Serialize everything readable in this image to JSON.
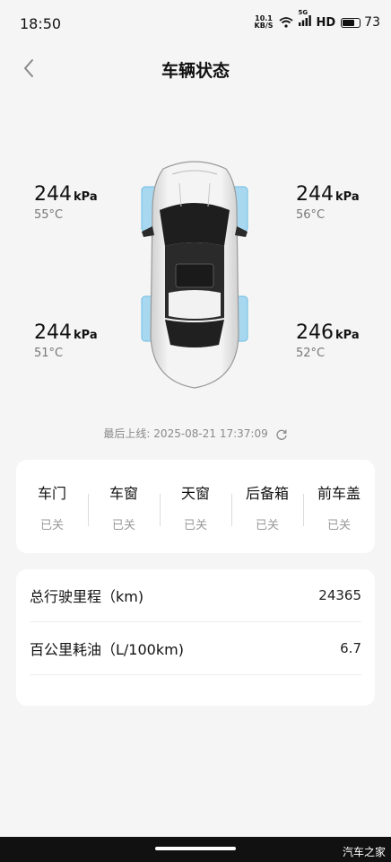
{
  "status_bar": {
    "time": "18:50",
    "speed_top": "10.1",
    "speed_bottom": "KB/S",
    "network": "5G",
    "hd": "HD",
    "battery": "73",
    "battery_level": 0.73
  },
  "header": {
    "title": "车辆状态"
  },
  "tires": {
    "front_left": {
      "pressure": "244",
      "unit": "kPa",
      "temp": "55°C"
    },
    "front_right": {
      "pressure": "244",
      "unit": "kPa",
      "temp": "56°C"
    },
    "rear_left": {
      "pressure": "244",
      "unit": "kPa",
      "temp": "51°C"
    },
    "rear_right": {
      "pressure": "246",
      "unit": "kPa",
      "temp": "52°C"
    }
  },
  "last_online": {
    "label": "最后上线:",
    "time": "2025-08-21 17:37:09"
  },
  "status_items": [
    {
      "label": "车门",
      "value": "已关"
    },
    {
      "label": "车窗",
      "value": "已关"
    },
    {
      "label": "天窗",
      "value": "已关"
    },
    {
      "label": "后备箱",
      "value": "已关"
    },
    {
      "label": "前车盖",
      "value": "已关"
    }
  ],
  "info": [
    {
      "label": "总行驶里程（km)",
      "value": "24365"
    },
    {
      "label": "百公里耗油（L/100km)",
      "value": "6.7"
    }
  ],
  "watermark": "汽车之家",
  "colors": {
    "tire_highlight": "#a8d8f0",
    "background": "#f5f5f5"
  }
}
